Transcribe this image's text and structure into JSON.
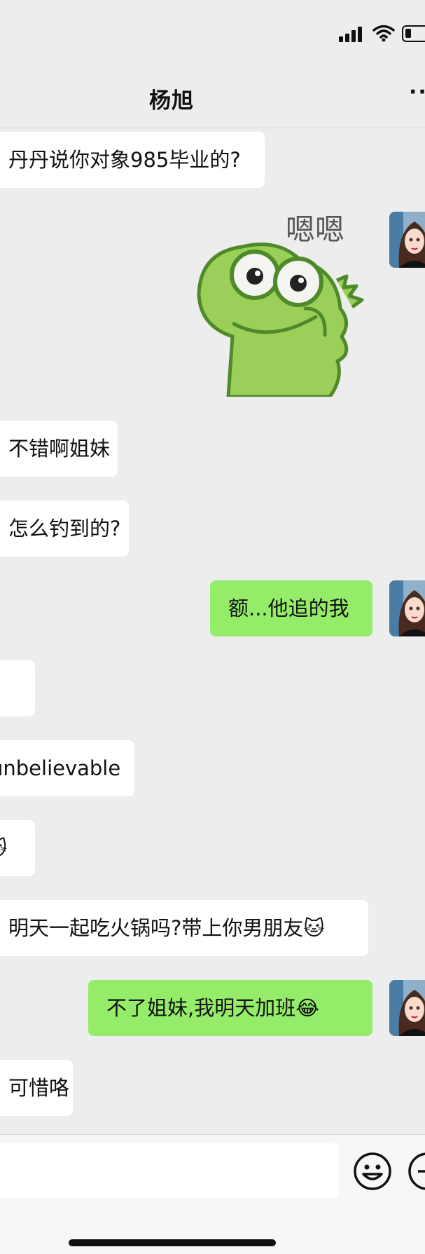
{
  "header": {
    "title": "杨旭",
    "more_label": "··"
  },
  "messages": [
    {
      "side": "in",
      "text": "丹丹说你对象985毕业的?"
    },
    {
      "side": "out",
      "type": "sticker",
      "sticker_text": "嗯嗯"
    },
    {
      "side": "in",
      "text": "不错啊姐妹"
    },
    {
      "side": "in",
      "text": "怎么钓到的?"
    },
    {
      "side": "out",
      "text": "额...他追的我"
    },
    {
      "side": "in",
      "text": ""
    },
    {
      "side": "in",
      "text": "unbelievable"
    },
    {
      "side": "in",
      "text": "🐱"
    },
    {
      "side": "in",
      "text": "明天一起吃火锅吗?带上你男朋友🐱"
    },
    {
      "side": "out",
      "text": "不了姐妹,我明天加班😂"
    },
    {
      "side": "in",
      "text": "可惜咯"
    }
  ],
  "colors": {
    "background": "#ededed",
    "incoming_bubble": "#ffffff",
    "outgoing_bubble": "#95ec69"
  },
  "icons": [
    "cellular-signal-icon",
    "wifi-icon",
    "battery-icon",
    "more-icon",
    "emoji-icon",
    "plus-icon"
  ]
}
